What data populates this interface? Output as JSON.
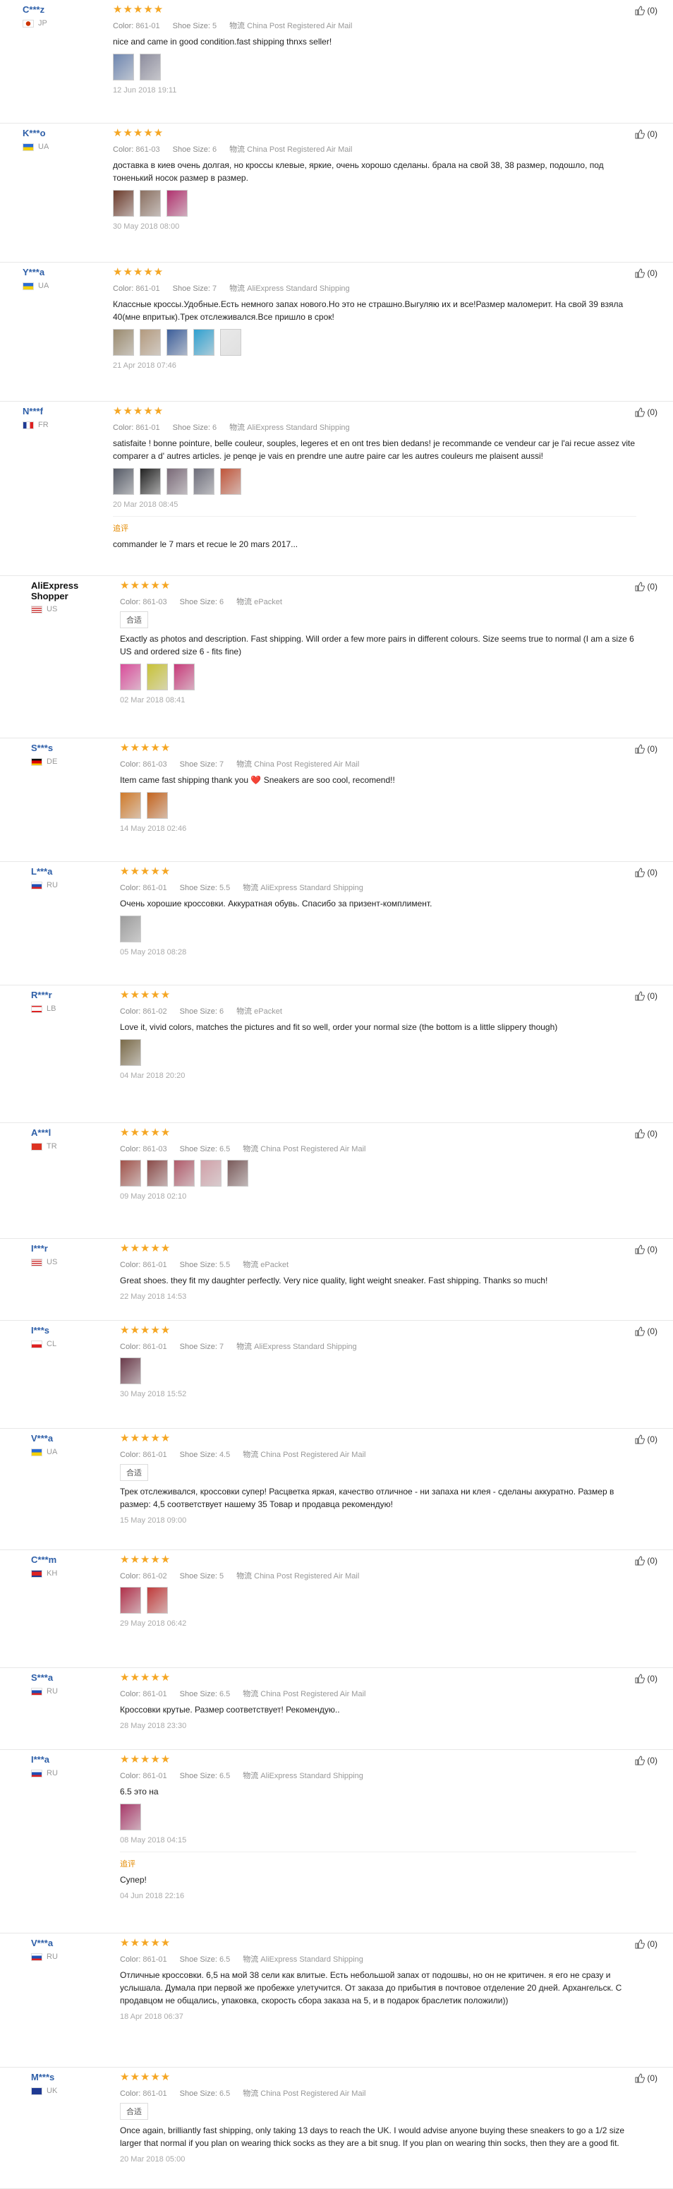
{
  "labels": {
    "color": "Color:",
    "size": "Shoe Size:",
    "ship_icon": "物流",
    "additional": "追评"
  },
  "reviews": [
    {
      "user": "C***z",
      "country": "JP",
      "flag": "jp",
      "color": "861-01",
      "size": "5",
      "shipping": "China Post Registered Air Mail",
      "text": "nice and came in good condition.fast shipping thnxs seller!",
      "photos": [
        "#6e86b0",
        "#8d8d9e"
      ],
      "date": "12 Jun 2018 19:11",
      "helpful": "(0)"
    },
    {
      "user": "K***o",
      "country": "UA",
      "flag": "ua",
      "color": "861-03",
      "size": "6",
      "shipping": "China Post Registered Air Mail",
      "text": "доставка в киев очень долгая, но кроссы клевые, яркие, очень хорошо сделаны. брала на свой 38, 38 размер, подошло, под тоненький носок размер в размер.",
      "photos": [
        "#6b3a2a",
        "#8a6f60",
        "#b0326e"
      ],
      "date": "30 May 2018 08:00",
      "helpful": "(0)"
    },
    {
      "user": "Y***a",
      "country": "UA",
      "flag": "ua",
      "color": "861-01",
      "size": "7",
      "shipping": "AliExpress Standard Shipping",
      "text": "Классные кроссы.Удобные.Есть немного запах нового.Но это не страшно.Выгуляю их и все!Размер маломерит. На свой 39 взяла 40(мне впритык).Трек отслеживался.Все пришло в срок!",
      "photos": [
        "#9a8a6e",
        "#b39a7e",
        "#3c5e9a",
        "#2fa0d0",
        "#e9e9e9"
      ],
      "date": "21 Apr 2018 07:46",
      "helpful": "(0)"
    },
    {
      "user": "N***f",
      "country": "FR",
      "flag": "fr",
      "color": "861-01",
      "size": "6",
      "shipping": "AliExpress Standard Shipping",
      "text": "satisfaite ! bonne pointure, belle couleur, souples, legeres et en ont tres bien dedans! je recommande ce vendeur car je l'ai recue assez vite comparer a d' autres articles. je penqe je vais en prendre une autre paire car les autres couleurs me plaisent aussi!",
      "photos": [
        "#555a66",
        "#222222",
        "#7a6a78",
        "#6d6d7a",
        "#c0553a"
      ],
      "date": "20 Mar 2018 08:45",
      "helpful": "(0)",
      "add_text": "commander le 7 mars et recue le 20 mars 2017..."
    },
    {
      "user": "AliExpress Shopper",
      "shopper": true,
      "country": "US",
      "flag": "us",
      "color": "861-03",
      "size": "6",
      "shipping": "ePacket",
      "tag": "合适",
      "text": "Exactly as photos and description. Fast shipping. Will order a few more pairs in different colours. Size seems true to normal (I am a size 6 US and ordered size 6 - fits fine)",
      "photos": [
        "#d94d9a",
        "#c8c236",
        "#c83a7a"
      ],
      "date": "02 Mar 2018 08:41",
      "helpful": "(0)"
    },
    {
      "user": "S***s",
      "country": "DE",
      "flag": "de",
      "color": "861-03",
      "size": "7",
      "shipping": "China Post Registered Air Mail",
      "text": "Item came fast shipping thank you ❤️ Sneakers are soo cool, recomend!!",
      "photos": [
        "#d07a2a",
        "#c4641e"
      ],
      "date": "14 May 2018 02:46",
      "helpful": "(0)"
    },
    {
      "user": "L***a",
      "country": "RU",
      "flag": "ru",
      "color": "861-01",
      "size": "5.5",
      "shipping": "AliExpress Standard Shipping",
      "text": "Очень хорошие кроссовки. Аккуратная обувь. Спасибо за призент-комплимент.",
      "photos": [
        "#9c9c9c"
      ],
      "date": "05 May 2018 08:28",
      "helpful": "(0)"
    },
    {
      "user": "R***r",
      "country": "LB",
      "flag": "lb",
      "color": "861-02",
      "size": "6",
      "shipping": "ePacket",
      "text": "Love it, vivid colors, matches the pictures and fit so well, order your normal size (the bottom is a little slippery though)",
      "photos": [
        "#7a6a48"
      ],
      "date": "04 Mar 2018 20:20",
      "helpful": "(0)"
    },
    {
      "user": "A***l",
      "country": "TR",
      "flag": "tr",
      "color": "861-03",
      "size": "6.5",
      "shipping": "China Post Registered Air Mail",
      "text": "",
      "photos": [
        "#a0524a",
        "#8a4a48",
        "#b05a6a",
        "#d0a0a8",
        "#7a5a5a"
      ],
      "date": "09 May 2018 02:10",
      "helpful": "(0)"
    },
    {
      "user": "I***r",
      "country": "US",
      "flag": "us",
      "color": "861-01",
      "size": "5.5",
      "shipping": "ePacket",
      "text": "Great shoes. they fit my daughter perfectly. Very nice quality, light weight sneaker. Fast shipping. Thanks so much!",
      "photos": [],
      "date": "22 May 2018 14:53",
      "helpful": "(0)"
    },
    {
      "user": "I***s",
      "country": "CL",
      "flag": "cl",
      "color": "861-01",
      "size": "7",
      "shipping": "AliExpress Standard Shipping",
      "text": "",
      "photos": [
        "#6a3a4a"
      ],
      "date": "30 May 2018 15:52",
      "helpful": "(0)"
    },
    {
      "user": "V***a",
      "country": "UA",
      "flag": "ua",
      "color": "861-01",
      "size": "4.5",
      "shipping": "China Post Registered Air Mail",
      "tag": "合适",
      "text": "Трек отслеживался, кроссовки супер! Расцветка яркая, качество отличное - ни запаха ни клея - сделаны аккуратно. Размер в размер: 4,5 соответствует нашему 35 Товар и продавца рекомендую!",
      "photos": [],
      "date": "15 May 2018 09:00",
      "helpful": "(0)"
    },
    {
      "user": "C***m",
      "country": "KH",
      "flag": "kh",
      "color": "861-02",
      "size": "5",
      "shipping": "China Post Registered Air Mail",
      "text": "",
      "photos": [
        "#b0304a",
        "#c03a3a"
      ],
      "date": "29 May 2018 06:42",
      "helpful": "(0)"
    },
    {
      "user": "S***a",
      "country": "RU",
      "flag": "ru",
      "color": "861-01",
      "size": "6.5",
      "shipping": "China Post Registered Air Mail",
      "text": "Кроссовки крутые. Размер соответствует! Рекомендую..",
      "photos": [],
      "date": "28 May 2018 23:30",
      "helpful": "(0)"
    },
    {
      "user": "I***a",
      "country": "RU",
      "flag": "ru",
      "color": "861-01",
      "size": "6.5",
      "shipping": "AliExpress Standard Shipping",
      "text": "6.5 это на",
      "photos": [
        "#a83a6a"
      ],
      "date": "08 May 2018 04:15",
      "helpful": "(0)",
      "add_text": "Супер!",
      "add_date": "04 Jun 2018 22:16"
    },
    {
      "user": "V***a",
      "country": "RU",
      "flag": "ru",
      "color": "861-01",
      "size": "6.5",
      "shipping": "AliExpress Standard Shipping",
      "text": "Отличные кроссовки. 6,5 на мой 38 сели как влитые. Есть небольшой запах от подошвы, но он не критичен. я его не сразу и услышала. Думала при первой же пробежке улетучится. От заказа до прибытия в почтовое отделение 20 дней. Архангельск. С продавцом не общались, упаковка, скорость сбора заказа на 5, и в подарок браслетик положили))",
      "photos": [],
      "date": "18 Apr 2018 06:37",
      "helpful": "(0)"
    },
    {
      "user": "M***s",
      "country": "UK",
      "flag": "uk",
      "color": "861-01",
      "size": "6.5",
      "shipping": "China Post Registered Air Mail",
      "tag": "合适",
      "text": "Once again, brilliantly fast shipping, only taking 13 days to reach the UK. I would advise anyone buying these sneakers to go a 1/2 size larger that normal if you plan on wearing thick socks as they are a bit snug. If you plan on wearing thin socks, then they are a good fit.",
      "photos": [],
      "date": "20 Mar 2018 05:00",
      "helpful": "(0)"
    }
  ]
}
